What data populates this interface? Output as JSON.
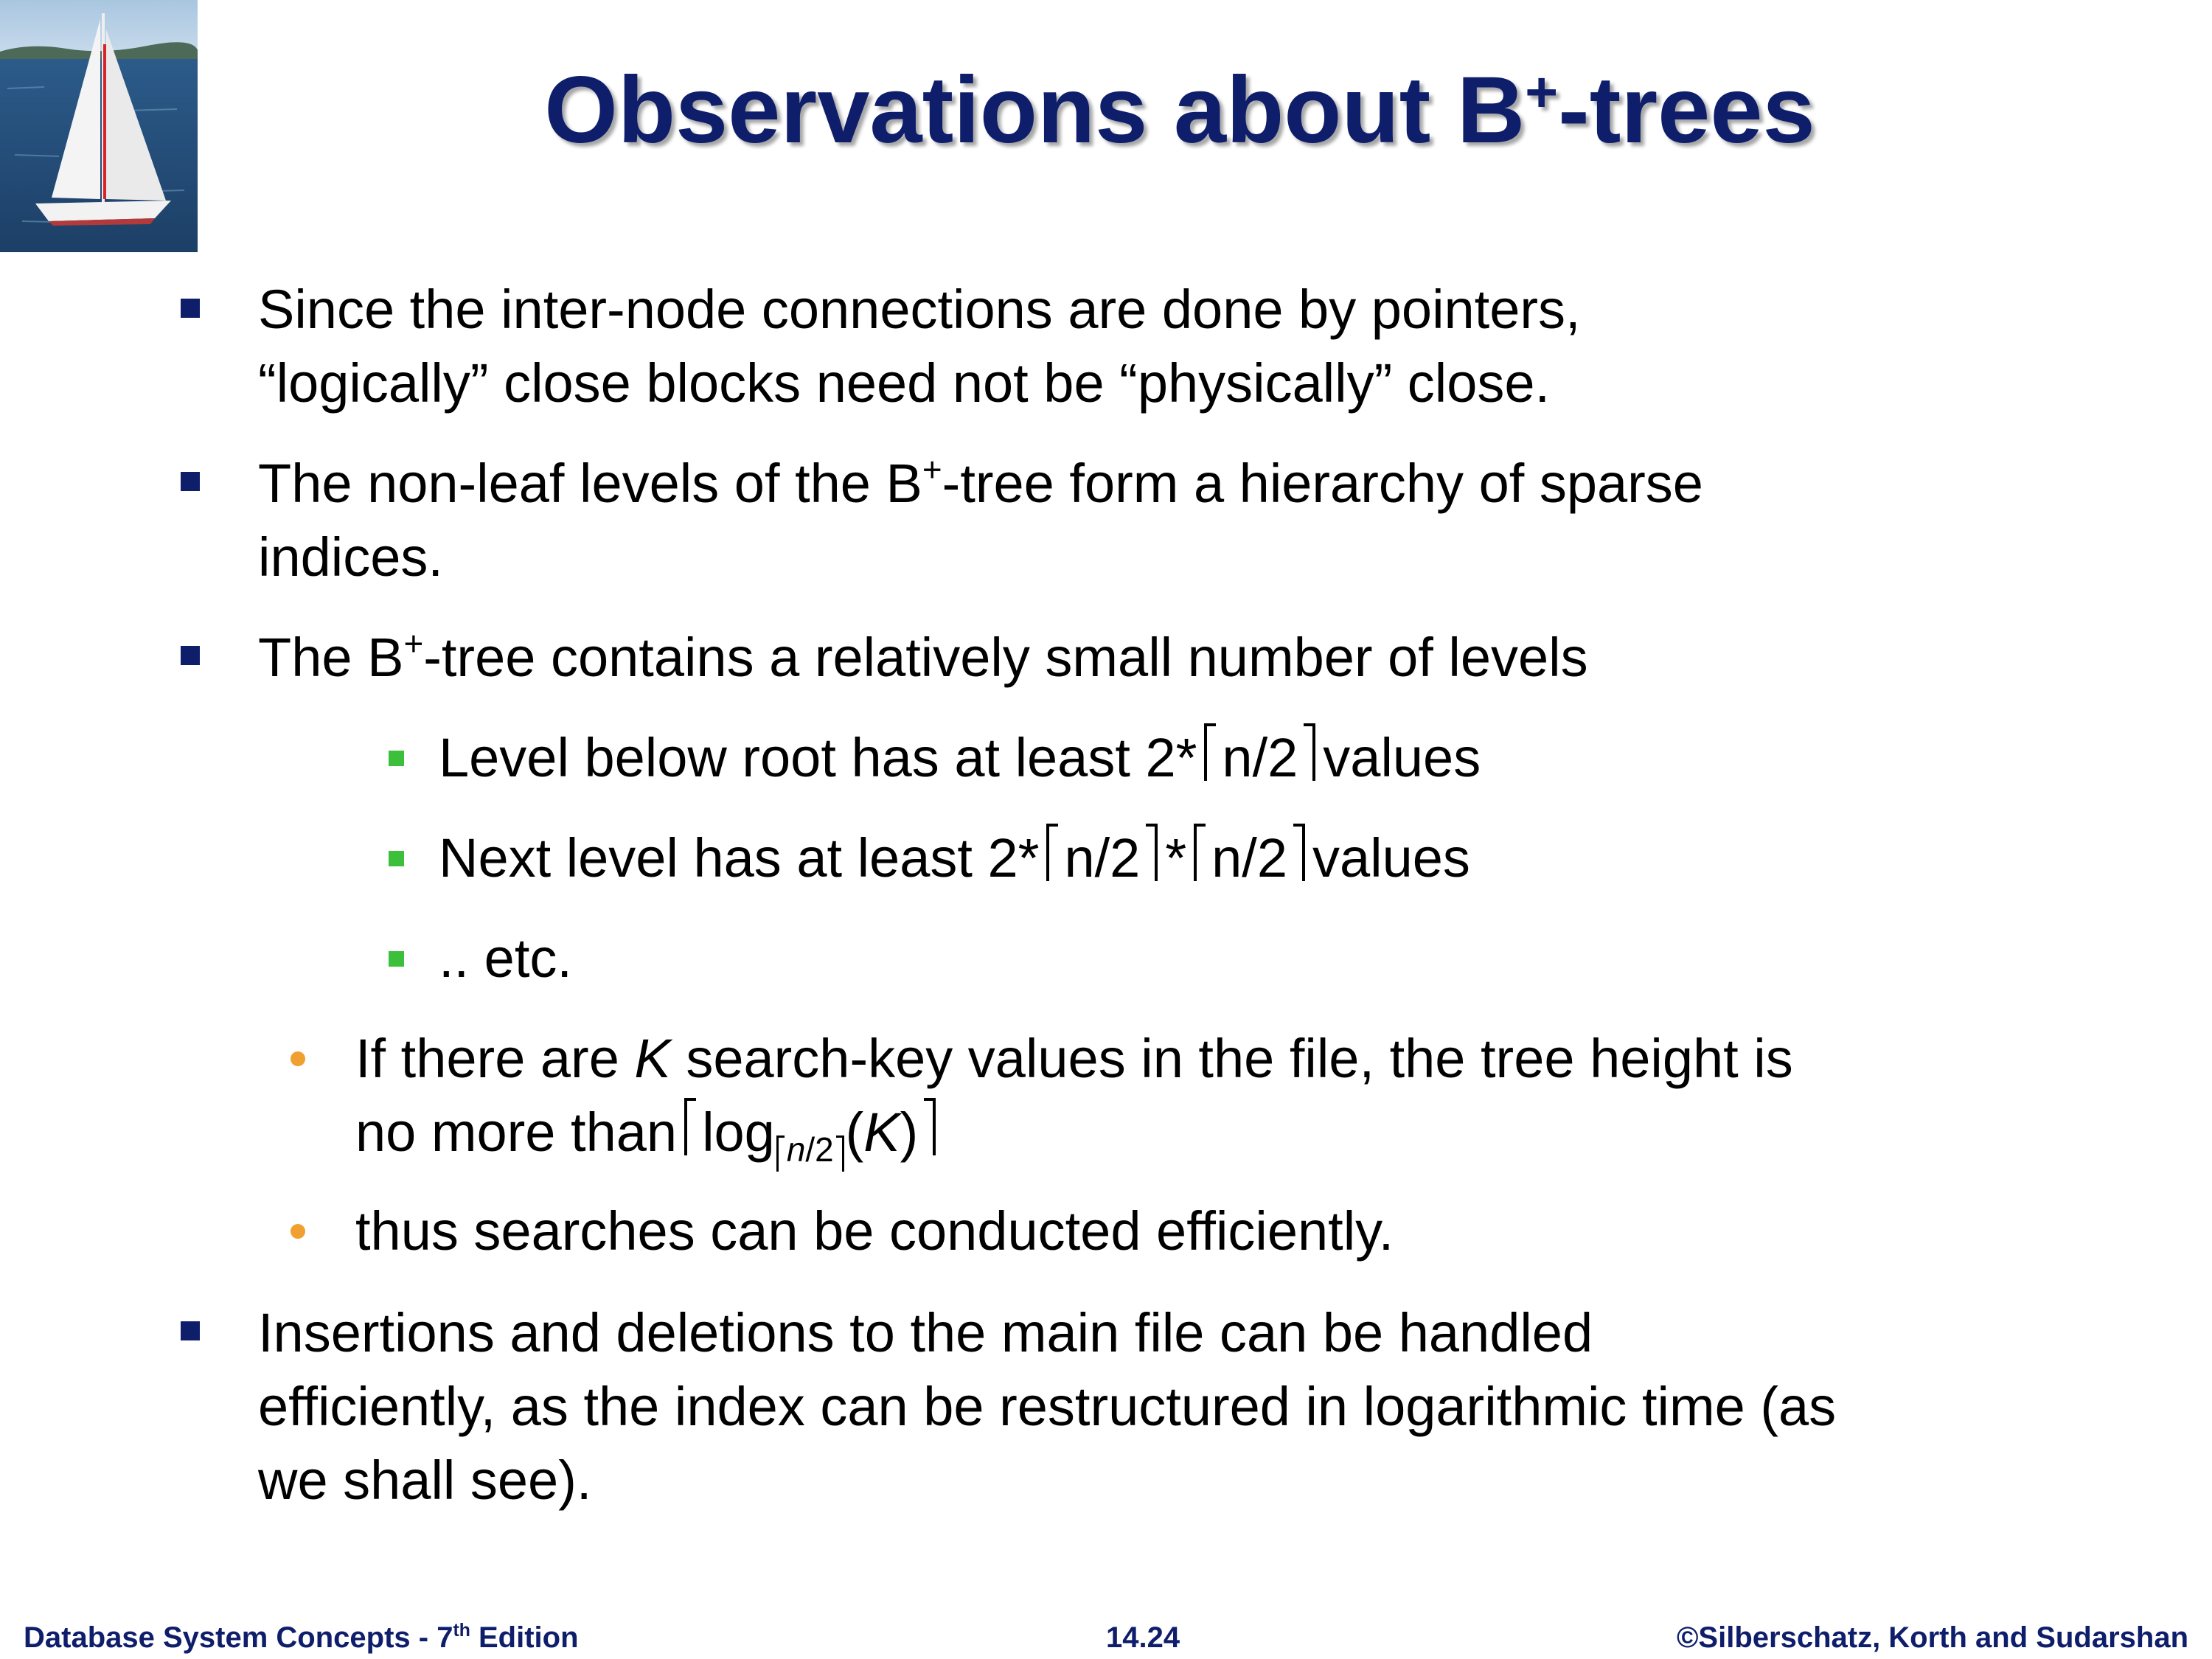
{
  "title": {
    "pre": "Observations about B",
    "sup": "+",
    "post": "-trees"
  },
  "bullets": {
    "b1": {
      "line1": "Since the inter-node connections are done by pointers,",
      "line2": "“logically” close blocks need not be “physically” close."
    },
    "b2": {
      "line1_pre": "The non-leaf levels of the B",
      "line1_sup": "+",
      "line1_post": "-tree form a hierarchy of sparse",
      "line2": "indices."
    },
    "b3": {
      "pre": "The B",
      "sup": "+",
      "post": "-tree contains a relatively small number of levels"
    },
    "s1": {
      "pre": "Level below root has at least 2*",
      "ceil": "n/2",
      "post": "values"
    },
    "s2": {
      "pre": "Next level has at least 2*",
      "ceil1": "n/2",
      "mid": "*",
      "ceil2": "n/2",
      "post": "values"
    },
    "s3": {
      "text": ".. etc."
    },
    "o1": {
      "line1_pre": "If there are ",
      "line1_k": "K",
      "line1_post": " search-key values in the file, the tree height is",
      "line2_pre": "no more than",
      "log": "log",
      "sub_n": "n",
      "sub_rest": "/2",
      "arg_open": "(",
      "arg_k": "K",
      "arg_close": ")"
    },
    "o2": {
      "text": "thus searches can be conducted efficiently."
    },
    "b4": {
      "line1": "Insertions and deletions to the main file can be handled",
      "line2": "efficiently, as the index can be restructured in logarithmic time (as",
      "line3": "we shall see)."
    }
  },
  "footer": {
    "left_pre": "Database System Concepts - 7",
    "left_sup": "th",
    "left_post": " Edition",
    "center": "14.24",
    "right": "©Silberschatz, Korth and Sudarshan"
  },
  "colors": {
    "title": "#0f1e6b",
    "bullet_primary": "#0f1e6b",
    "bullet_secondary": "#3cc03c",
    "bullet_tertiary": "#f0a030"
  }
}
